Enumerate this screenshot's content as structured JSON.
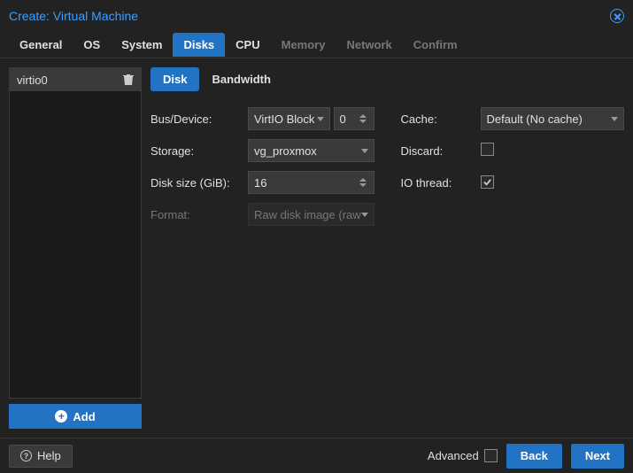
{
  "title": "Create: Virtual Machine",
  "tabs": [
    "General",
    "OS",
    "System",
    "Disks",
    "CPU",
    "Memory",
    "Network",
    "Confirm"
  ],
  "activeTabIndex": 3,
  "disabledTabs": [
    5,
    6,
    7
  ],
  "sidebar": {
    "items": [
      {
        "label": "virtio0"
      }
    ],
    "add_label": "Add"
  },
  "subtabs": [
    "Disk",
    "Bandwidth"
  ],
  "activeSubtabIndex": 0,
  "form": {
    "bus_label": "Bus/Device:",
    "bus_value": "VirtIO Block",
    "bus_index": "0",
    "storage_label": "Storage:",
    "storage_value": "vg_proxmox",
    "size_label": "Disk size (GiB):",
    "size_value": "16",
    "format_label": "Format:",
    "format_value": "Raw disk image (raw",
    "cache_label": "Cache:",
    "cache_value": "Default (No cache)",
    "discard_label": "Discard:",
    "discard_checked": false,
    "iothread_label": "IO thread:",
    "iothread_checked": true
  },
  "footer": {
    "help_label": "Help",
    "advanced_label": "Advanced",
    "advanced_checked": false,
    "back_label": "Back",
    "next_label": "Next"
  }
}
